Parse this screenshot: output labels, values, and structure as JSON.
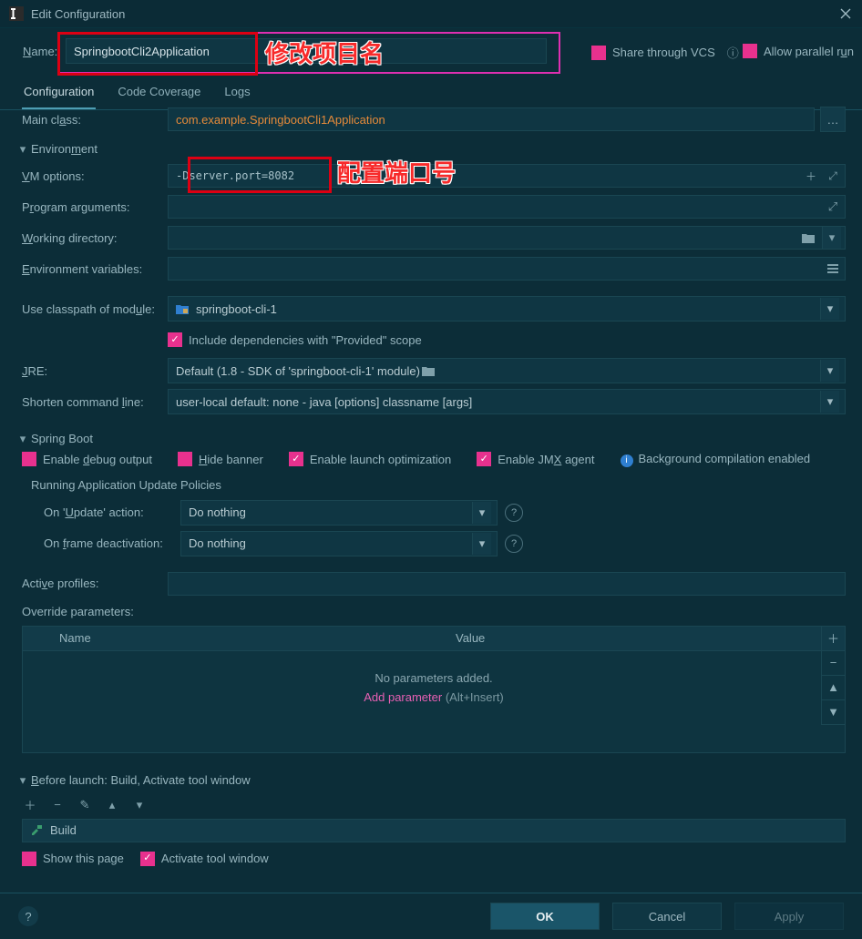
{
  "title": "Edit Configuration",
  "name_label_pre": "N",
  "name_label_post": "ame:",
  "name_value": "SpringbootCli2Application",
  "annot_name": "修改项目名",
  "share_label": "Share through VCS",
  "allow_label": "Allow parallel r",
  "allow_label_u": "u",
  "allow_label_post": "n",
  "tabs": {
    "config": "Configuration",
    "coverage": "Code Coverage",
    "logs": "Logs"
  },
  "main_class_label": "Main cl",
  "main_class_u": "a",
  "main_class_post": "ss:",
  "main_class_value": "com.example.SpringbootCli1Application",
  "env_section": "Environ",
  "env_section_u": "m",
  "env_section_post": "ent",
  "vm_label_u": "V",
  "vm_label_post": "M options:",
  "vm_value": "-Dserver.port=8082",
  "annot_vm": "配置端口号",
  "prog_label": "P",
  "prog_u": "r",
  "prog_post": "ogram arguments:",
  "wd_u": "W",
  "wd_post": "orking directory:",
  "env_u": "E",
  "env_post": "nvironment variables:",
  "ucm_label": "Use classpath of mod",
  "ucm_u": "u",
  "ucm_post": "le:",
  "ucm_value": "springboot-cli-1",
  "include_label": "Include dependencies with \"Provided\" scope",
  "jre_u": "J",
  "jre_post": "RE:",
  "jre_value": "Default ",
  "jre_dim": "(1.8 - SDK of 'springboot-cli-1' module)",
  "shorten_label": "Shorten command ",
  "shorten_u": "l",
  "shorten_post": "ine:",
  "shorten_value": "user-local default: none ",
  "shorten_dim": "- java [options] classname [args]",
  "spring_section": "Spring Boot",
  "enable_debug": "Enable ",
  "enable_debug_u": "d",
  "enable_debug_post": "ebug output",
  "hide_u": "H",
  "hide_post": "ide banner",
  "launch_opt": "Enable launch optimization",
  "jmx": "Enable JM",
  "jmx_u": "X",
  "jmx_post": " agent",
  "bg_compile": "Background compilation enabled",
  "rap": "Running Application Update Policies",
  "on_update": "On '",
  "on_update_u": "U",
  "on_update_post": "pdate' action:",
  "on_frame": "On ",
  "on_frame_u": "f",
  "on_frame_post": "rame deactivation:",
  "do_nothing": "Do nothing",
  "active_profiles": "Acti",
  "active_profiles_u": "v",
  "active_profiles_post": "e profiles:",
  "override": "Override parameters:",
  "col_name": "Name",
  "col_value": "Value",
  "no_params": "No parameters added.",
  "add_param": "Add parameter",
  "add_hint": " (Alt+Insert)",
  "before_u": "B",
  "before_post": "efore launch: Build, Activate tool window",
  "build_item": "Build",
  "show_page": "Show this page",
  "activate_tw": "Activate tool window",
  "ok": "OK",
  "cancel": "Cancel",
  "apply": "Apply"
}
